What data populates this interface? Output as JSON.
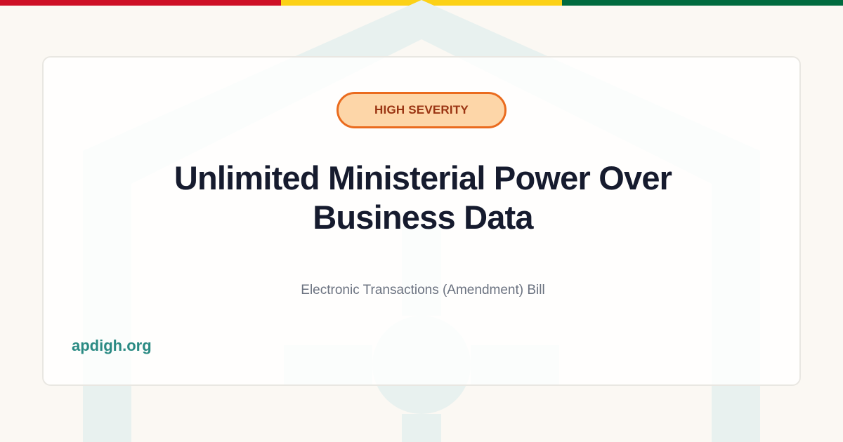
{
  "colors": {
    "flag_red": "#ce1126",
    "flag_yellow": "#fcd116",
    "flag_green": "#006b3f",
    "background": "#fbf8f3",
    "watermark": "#e8f1ef",
    "badge_fill": "#fdd6a8",
    "badge_border": "#ea6b1e",
    "badge_text": "#9a3412",
    "title": "#161b2e",
    "subtitle": "#6b7280",
    "site": "#2a8a83"
  },
  "background_icon": "house-with-person-watermark-icon",
  "badge": {
    "label": "HIGH SEVERITY"
  },
  "title": {
    "line1": "Unlimited Ministerial Power Over",
    "line2": "Business Data"
  },
  "subtitle": "Electronic Transactions (Amendment) Bill",
  "site": "apdigh.org"
}
